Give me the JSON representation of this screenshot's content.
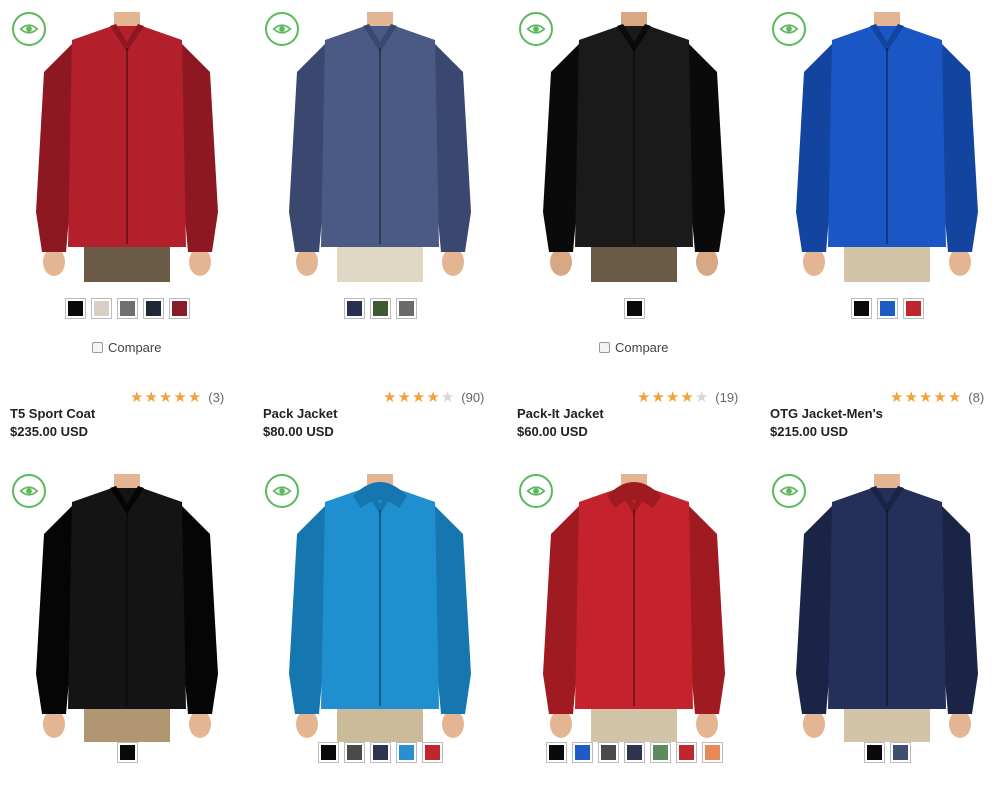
{
  "quick_view_icon": "eye-icon",
  "colors": {
    "accent_green": "#5cb85c",
    "star_gold": "#f0a33a"
  },
  "products": [
    {
      "name": "",
      "price": "",
      "rating": null,
      "review_count": "",
      "compare_label": "Compare",
      "show_compare": true,
      "swatches": [
        "#0a0a0a",
        "#d9cdc4",
        "#707070",
        "#202838",
        "#8a1a2a"
      ]
    },
    {
      "name": "",
      "price": "",
      "rating": null,
      "review_count": "",
      "compare_label": "",
      "show_compare": false,
      "swatches": [
        "#283250",
        "#3e5a30",
        "#6a6a6a"
      ]
    },
    {
      "name": "",
      "price": "",
      "rating": null,
      "review_count": "",
      "compare_label": "Compare",
      "show_compare": true,
      "swatches": [
        "#0a0a0a"
      ]
    },
    {
      "name": "",
      "price": "",
      "rating": null,
      "review_count": "",
      "compare_label": "",
      "show_compare": false,
      "swatches": [
        "#0a0a0a",
        "#1f5bc4",
        "#c0262e"
      ]
    },
    {
      "name": "T5 Sport Coat",
      "price": "$235.00 USD",
      "rating": 5,
      "review_count": "(3)",
      "compare_label": "",
      "show_compare": false,
      "swatches": [
        "#0a0a0a"
      ]
    },
    {
      "name": "Pack Jacket",
      "price": "$80.00 USD",
      "rating": 4,
      "review_count": "(90)",
      "compare_label": "",
      "show_compare": false,
      "swatches": [
        "#0a0a0a",
        "#4a4a4a",
        "#2c3450",
        "#2a8ed0",
        "#c0262e"
      ]
    },
    {
      "name": "Pack-It Jacket",
      "price": "$60.00 USD",
      "rating": 4,
      "review_count": "(19)",
      "compare_label": "",
      "show_compare": false,
      "swatches": [
        "#0a0a0a",
        "#1f5bc4",
        "#4a4a4a",
        "#2c3450",
        "#5d8a5e",
        "#c0262e",
        "#e68a5c"
      ]
    },
    {
      "name": "OTG Jacket-Men's",
      "price": "$215.00 USD",
      "rating": 5,
      "review_count": "(8)",
      "compare_label": "",
      "show_compare": false,
      "swatches": [
        "#0a0a0a",
        "#3d5070"
      ]
    }
  ],
  "garments": [
    {
      "body": "#b3202b",
      "shade": "#8e1822",
      "pants": "#6b5a46",
      "skin": "#e3b592"
    },
    {
      "body": "#4a5a85",
      "shade": "#3a4870",
      "pants": "#e0d7c5",
      "skin": "#e3b592"
    },
    {
      "body": "#1a1a1a",
      "shade": "#0a0a0a",
      "pants": "#6b5a46",
      "skin": "#d8a884"
    },
    {
      "body": "#1a56c4",
      "shade": "#1244a0",
      "pants": "#d2c4a8",
      "skin": "#e3b592"
    },
    {
      "body": "#141414",
      "shade": "#050505",
      "pants": "#b09772",
      "skin": "#e3b592"
    },
    {
      "body": "#1f8fcf",
      "shade": "#1676b0",
      "pants": "#cbbb9a",
      "skin": "#e3b592"
    },
    {
      "body": "#c4222c",
      "shade": "#a01a22",
      "pants": "#d2c4a8",
      "skin": "#e3b592"
    },
    {
      "body": "#24305a",
      "shade": "#1a2446",
      "pants": "#d2c4a8",
      "skin": "#e3b592"
    }
  ]
}
